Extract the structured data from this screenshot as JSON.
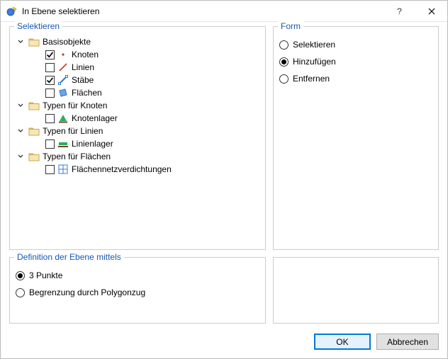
{
  "window": {
    "title": "In Ebene selektieren",
    "helpLabel": "?",
    "closeLabel": "×"
  },
  "select": {
    "legend": "Selektieren",
    "groups": [
      {
        "label": "Basisobjekte",
        "items": [
          {
            "label": "Knoten",
            "checked": true,
            "icon": "node"
          },
          {
            "label": "Linien",
            "checked": false,
            "icon": "line"
          },
          {
            "label": "Stäbe",
            "checked": true,
            "icon": "member"
          },
          {
            "label": "Flächen",
            "checked": false,
            "icon": "surface"
          }
        ]
      },
      {
        "label": "Typen für Knoten",
        "items": [
          {
            "label": "Knotenlager",
            "checked": false,
            "icon": "support"
          }
        ]
      },
      {
        "label": "Typen für Linien",
        "items": [
          {
            "label": "Linienlager",
            "checked": false,
            "icon": "linesupport"
          }
        ]
      },
      {
        "label": "Typen für Flächen",
        "items": [
          {
            "label": "Flächennetzverdichtungen",
            "checked": false,
            "icon": "meshref"
          }
        ]
      }
    ]
  },
  "form": {
    "legend": "Form",
    "options": [
      {
        "label": "Selektieren",
        "checked": false
      },
      {
        "label": "Hinzufügen",
        "checked": true
      },
      {
        "label": "Entfernen",
        "checked": false
      }
    ]
  },
  "definition": {
    "legend": "Definition der Ebene mittels",
    "options": [
      {
        "label": "3 Punkte",
        "checked": true
      },
      {
        "label": "Begrenzung durch Polygonzug",
        "checked": false
      }
    ]
  },
  "buttons": {
    "ok": "OK",
    "cancel": "Abbrechen"
  }
}
